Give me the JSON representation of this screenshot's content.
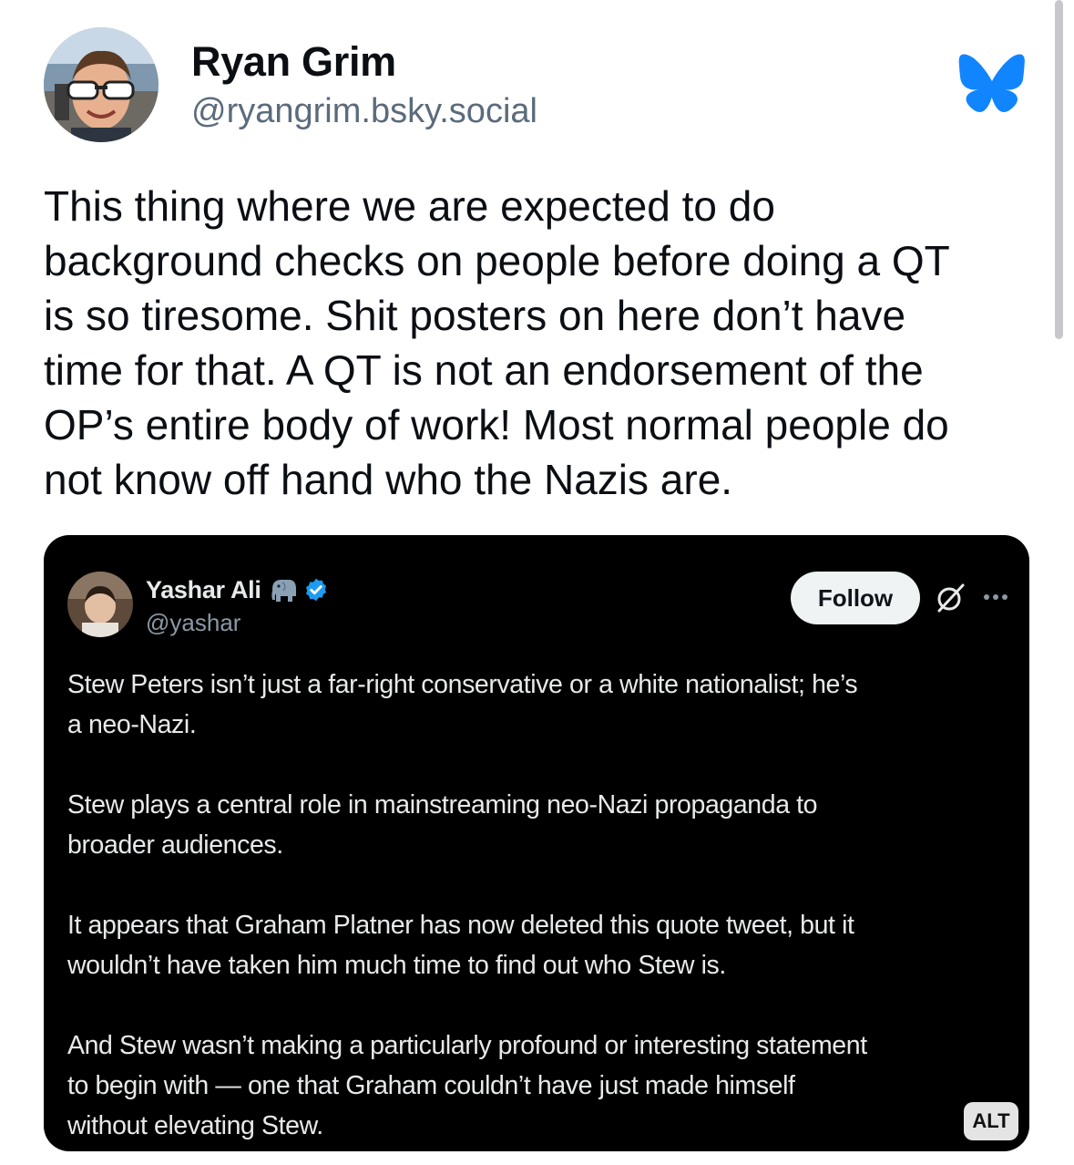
{
  "post": {
    "author_name": "Ryan Grim",
    "author_handle": "@ryangrim.bsky.social",
    "platform_icon": "bluesky-butterfly-icon",
    "text": "This thing where we are expected to do\nbackground checks on people before doing a QT\nis so tiresome. Shit posters on here don’t have\ntime for that. A QT is not an endorsement of the\nOP’s entire body of work! Most normal people do\nnot know off hand who the Nazis are."
  },
  "embed": {
    "name": "Yashar Ali",
    "handle": "@yashar",
    "follow_label": "Follow",
    "alt_label": "ALT",
    "paragraphs": [
      "Stew Peters isn’t just a far-right conservative or a white nationalist; he’s\na neo-Nazi.",
      "Stew plays a central role in mainstreaming neo-Nazi propaganda to\nbroader audiences.",
      "It appears that Graham Platner has now deleted this quote tweet, but it\nwouldn’t have taken him much time to find out who Stew is.",
      "And Stew wasn’t making a particularly profound or interesting statement\nto begin with — one that Graham couldn’t have just made himself\nwithout elevating Stew."
    ]
  },
  "colors": {
    "bluesky_blue": "#1185fe",
    "verified_blue": "#1d9bf0",
    "handle_gray": "#5b6b7d",
    "embed_bg": "#000000"
  }
}
